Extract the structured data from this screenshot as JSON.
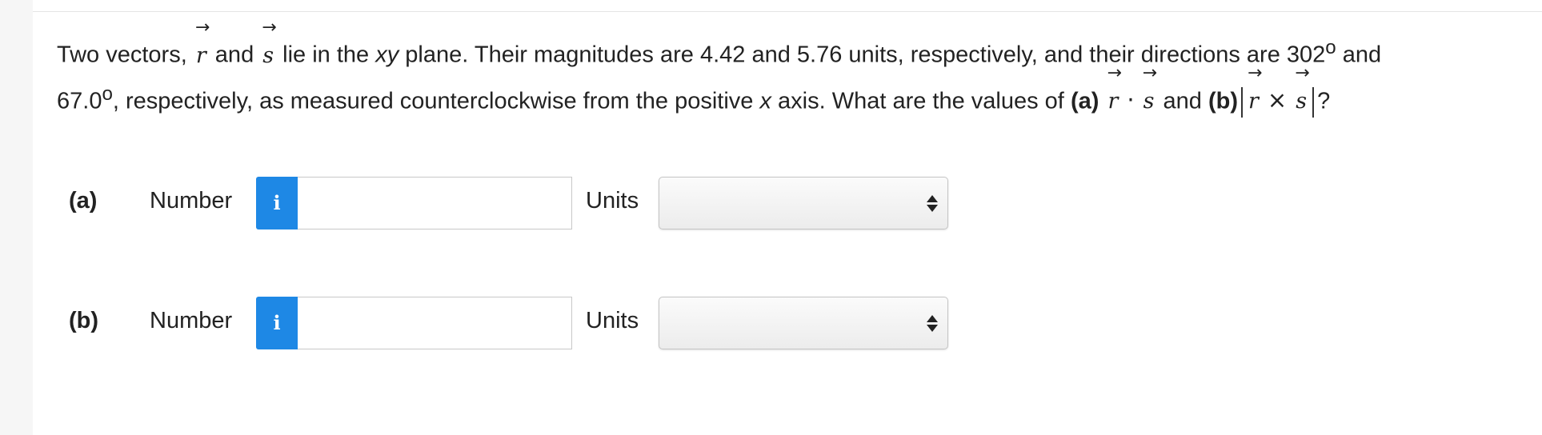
{
  "question": {
    "p1": "Two vectors, ",
    "vec_r": "r",
    "vec_s": "s",
    "arrow": "→",
    "and": " and ",
    "p2": " lie in the ",
    "xy": "xy",
    "p3": " plane. Their magnitudes are 4.42 and 5.76 units, respectively, and their directions are 302",
    "deg": "o",
    "p4": " and",
    "p5": "67.0",
    "p6": ", respectively, as measured counterclockwise from the positive ",
    "x": "x",
    "p7": " axis. What are the values of ",
    "part_a": "(a)",
    "dot": "·",
    "part_b": "(b)",
    "cross": "×",
    "end": "?"
  },
  "answers": [
    {
      "label": "(a)",
      "number_label": "Number",
      "info_glyph": "i",
      "value": "",
      "units_label": "Units",
      "units_value": ""
    },
    {
      "label": "(b)",
      "number_label": "Number",
      "info_glyph": "i",
      "value": "",
      "units_label": "Units",
      "units_value": ""
    }
  ],
  "colors": {
    "info_button": "#1e88e5",
    "text": "#222222",
    "gutter": "#f6f6f6"
  },
  "icons": {
    "info": "info-icon",
    "select_arrows": "updown-arrows-icon"
  }
}
